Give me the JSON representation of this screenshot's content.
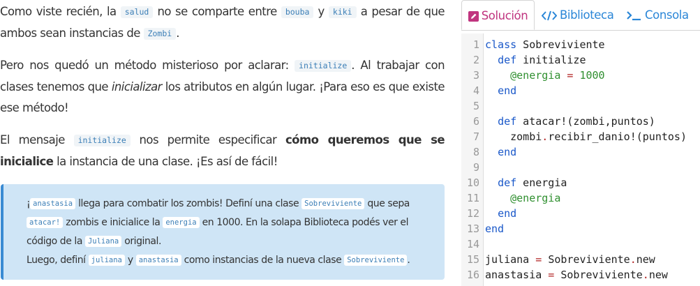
{
  "paragraphs": {
    "p1": {
      "t1": "Como viste recién, la ",
      "c1": "salud",
      "t2": " no se comparte entre ",
      "c2": "bouba",
      "t3": " y ",
      "c3": "kiki",
      "t4": " a pesar de que ambos sean instancias de ",
      "c4": "Zombi",
      "t5": "."
    },
    "p2": {
      "t1": "Pero nos quedó un método misterioso por aclarar: ",
      "c1": "initialize",
      "t2": ". Al trabajar con clases tenemos que ",
      "em": "inicializar",
      "t3": " los atributos en algún lugar. ¡Para eso es que existe ese método!"
    },
    "p3": {
      "t1": "El mensaje ",
      "c1": "initialize",
      "t2": " nos permite especificar ",
      "b": "cómo queremos que se inicialice",
      "t3": " la instancia de una clase. ¡Es así de fácil!"
    }
  },
  "callout": {
    "t1": "¡",
    "c1": "anastasia",
    "t2": " llega para combatir los zombis! Definí una clase ",
    "c2": "Sobreviviente",
    "t3": " que sepa ",
    "c3": "atacar!",
    "t4": " zombis e inicialice la ",
    "c4": "energia",
    "t5": " en 1000. En la solapa Biblioteca podés ver el código de la ",
    "c5": "Juliana",
    "t6": " original.",
    "t7": "Luego, definí ",
    "c6": "juliana",
    "t8": " y ",
    "c7": "anastasia",
    "t9": " como instancias de la nueva clase ",
    "c8": "Sobreviviente",
    "t10": "."
  },
  "tabs": {
    "solucion": "Solución",
    "biblioteca": "Biblioteca",
    "consola": "Consola"
  },
  "colors": {
    "active_tab": "#c0347f",
    "tab_link": "#2a86d7",
    "callout_bg": "#cfe5f6",
    "callout_border": "#3a8bd3",
    "keyword": "#1a58c9",
    "ivar": "#2f8f2f"
  },
  "editor": {
    "line_numbers": [
      "1",
      "2",
      "3",
      "4",
      "5",
      "6",
      "7",
      "8",
      "9",
      "10",
      "11",
      "12",
      "13",
      "14",
      "15",
      "16"
    ],
    "l1": {
      "kw": "class",
      "rest": " Sobreviviente"
    },
    "l2": {
      "indent": "  ",
      "kw": "def",
      "rest": " initialize"
    },
    "l3": {
      "indent": "    ",
      "ivar": "@energia",
      "op": " = ",
      "num": "1000"
    },
    "l4": {
      "indent": "  ",
      "kw": "end"
    },
    "l6": {
      "indent": "  ",
      "kw": "def",
      "rest": " atacar!(zombi,puntos)"
    },
    "l7": {
      "indent": "    ",
      "a": "zombi",
      "dot": ".",
      "b": "recibir_danio!(puntos)"
    },
    "l8": {
      "indent": "  ",
      "kw": "end"
    },
    "l10": {
      "indent": "  ",
      "kw": "def",
      "rest": " energia"
    },
    "l11": {
      "indent": "    ",
      "ivar": "@energia"
    },
    "l12": {
      "indent": "  ",
      "kw": "end"
    },
    "l13": {
      "kw": "end"
    },
    "l15": {
      "a": "juliana",
      "op": " = ",
      "b": "Sobreviviente",
      "dot": ".",
      "c": "new"
    },
    "l16": {
      "a": "anastasia",
      "op": " = ",
      "b": "Sobreviviente",
      "dot": ".",
      "c": "new"
    }
  }
}
